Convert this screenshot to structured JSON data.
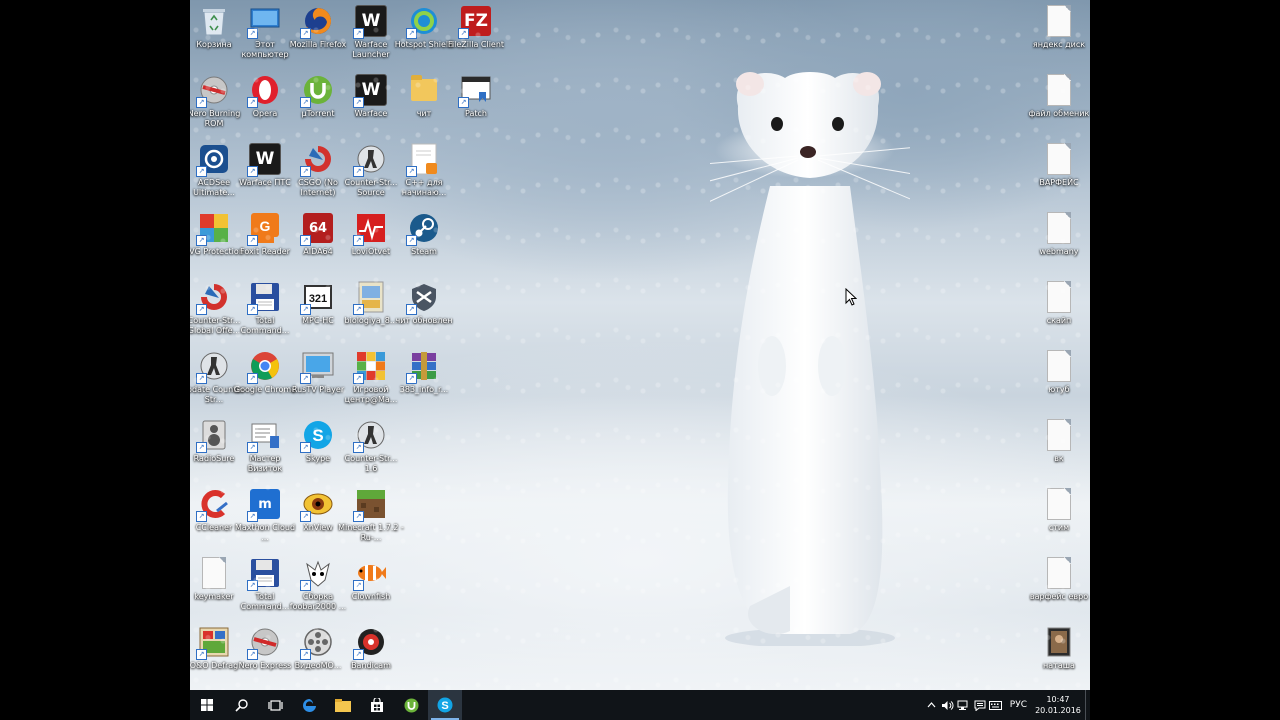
{
  "desktop": {
    "icons": [
      {
        "label": "Корзина",
        "icon": "recycle-bin-icon"
      },
      {
        "label": "Этот компьютер",
        "icon": "computer-icon"
      },
      {
        "label": "Mozilla Firefox",
        "icon": "firefox-icon"
      },
      {
        "label": "Warface Launcher",
        "icon": "warface-icon"
      },
      {
        "label": "Hotspot Shield",
        "icon": "hotspot-shield-icon"
      },
      {
        "label": "FileZilla Client",
        "icon": "filezilla-icon"
      },
      {
        "label": "Nero Burning ROM",
        "icon": "nero-icon"
      },
      {
        "label": "Opera",
        "icon": "opera-icon"
      },
      {
        "label": "µTorrent",
        "icon": "utorrent-icon"
      },
      {
        "label": "Warface",
        "icon": "warface-icon"
      },
      {
        "label": "чит",
        "icon": "folder-icon"
      },
      {
        "label": "Patch",
        "icon": "patch-icon"
      },
      {
        "label": "ACDSee Ultimate...",
        "icon": "acdsee-icon"
      },
      {
        "label": "Warface ПТС",
        "icon": "warface-icon"
      },
      {
        "label": "CSGO (No Internet)",
        "icon": "csgo-icon"
      },
      {
        "label": "Counter-Str... Source",
        "icon": "counter-strike-icon"
      },
      {
        "label": "C++ для начинаю...",
        "icon": "pdf-document-icon"
      },
      {
        "label": "AVG Protection",
        "icon": "avg-icon"
      },
      {
        "label": "Foxit Reader",
        "icon": "foxit-icon"
      },
      {
        "label": "AIDA64",
        "icon": "aida64-icon"
      },
      {
        "label": "LoviOtvet",
        "icon": "lovi-otvet-icon"
      },
      {
        "label": "Steam",
        "icon": "steam-icon"
      },
      {
        "label": "Counter-Str... Global Offe...",
        "icon": "csgo-icon"
      },
      {
        "label": "Total Command...",
        "icon": "floppy-icon"
      },
      {
        "label": "MPC-HC",
        "icon": "mpc-hc-icon"
      },
      {
        "label": "biologiya_8...",
        "icon": "book-icon"
      },
      {
        "label": "чит обновлен",
        "icon": "shield-cheat-icon"
      },
      {
        "label": "Update Counter-Str...",
        "icon": "counter-strike-icon"
      },
      {
        "label": "Google Chrome",
        "icon": "chrome-icon"
      },
      {
        "label": "RusTV Player",
        "icon": "tv-icon"
      },
      {
        "label": "Игровой центр@Ma...",
        "icon": "rubik-cube-icon"
      },
      {
        "label": "383_info_r...",
        "icon": "winrar-icon"
      },
      {
        "label": "RadioSure",
        "icon": "speaker-icon"
      },
      {
        "label": "Мастер Визиток",
        "icon": "business-card-icon"
      },
      {
        "label": "Skype",
        "icon": "skype-icon"
      },
      {
        "label": "Counter-Str... 1.6",
        "icon": "counter-strike-icon"
      },
      {
        "label": "CCleaner",
        "icon": "ccleaner-icon"
      },
      {
        "label": "Maxthon Cloud ...",
        "icon": "maxthon-icon"
      },
      {
        "label": "XnView",
        "icon": "xnview-icon"
      },
      {
        "label": "Minecraft 1.7.2 - Ru-...",
        "icon": "minecraft-icon"
      },
      {
        "label": "keymaker",
        "icon": "document-icon"
      },
      {
        "label": "Total Command...",
        "icon": "floppy-icon"
      },
      {
        "label": "Сборка foobar2000 ...",
        "icon": "foobar-icon"
      },
      {
        "label": "Clownfish",
        "icon": "clownfish-icon"
      },
      {
        "label": "O&O Defrag",
        "icon": "defrag-icon"
      },
      {
        "label": "Nero Express",
        "icon": "nero-icon"
      },
      {
        "label": "ВидеоМО...",
        "icon": "film-reel-icon"
      },
      {
        "label": "Bandicam",
        "icon": "bandicam-icon"
      }
    ],
    "right_icons": [
      {
        "label": "яндекс диск",
        "icon": "document-icon"
      },
      {
        "label": "файл обменик",
        "icon": "document-icon"
      },
      {
        "label": "ВАРФЕЙС",
        "icon": "document-icon"
      },
      {
        "label": "webmany",
        "icon": "document-icon"
      },
      {
        "label": "скайп",
        "icon": "document-icon"
      },
      {
        "label": "ютуб",
        "icon": "document-icon"
      },
      {
        "label": "вк",
        "icon": "document-icon"
      },
      {
        "label": "стим",
        "icon": "document-icon"
      },
      {
        "label": "варфейс евро",
        "icon": "document-icon"
      },
      {
        "label": "наташа",
        "icon": "photo-icon"
      }
    ]
  },
  "taskbar": {
    "buttons": [
      "start-icon",
      "search-icon",
      "task-view-icon",
      "edge-icon",
      "file-explorer-icon",
      "store-icon",
      "utorrent-icon",
      "skype-icon"
    ],
    "active": "skype-icon",
    "tray": {
      "language": "РУС",
      "time": "10:47",
      "date": "20.01.2016"
    }
  },
  "colors": {
    "taskbar": "#101418",
    "accent": "#7eb4ea"
  }
}
